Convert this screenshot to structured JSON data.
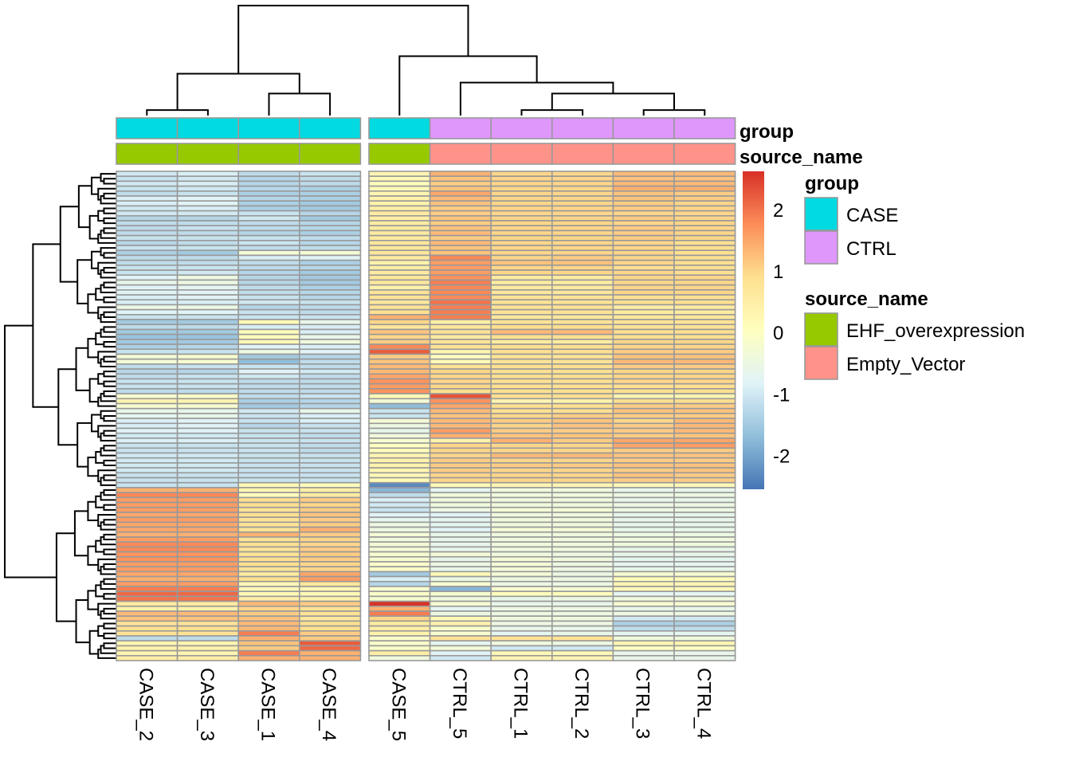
{
  "chart_data": {
    "type": "heatmap",
    "title": "",
    "columns": [
      "CASE_2",
      "CASE_3",
      "CASE_1",
      "CASE_4",
      "CASE_5",
      "CTRL_5",
      "CTRL_1",
      "CTRL_2",
      "CTRL_3",
      "CTRL_4"
    ],
    "column_split_after": 4,
    "row_count": 100,
    "annotations": {
      "group": {
        "label": "group",
        "values": [
          "CASE",
          "CASE",
          "CASE",
          "CASE",
          "CASE",
          "CTRL",
          "CTRL",
          "CTRL",
          "CTRL",
          "CTRL"
        ],
        "colors": {
          "CASE": "#00DAE0",
          "CTRL": "#DF97FC"
        }
      },
      "source_name": {
        "label": "source_name",
        "values": [
          "EHF_overexpression",
          "EHF_overexpression",
          "EHF_overexpression",
          "EHF_overexpression",
          "EHF_overexpression",
          "Empty_Vector",
          "Empty_Vector",
          "Empty_Vector",
          "Empty_Vector",
          "Empty_Vector"
        ],
        "colors": {
          "EHF_overexpression": "#97C900",
          "Empty_Vector": "#FF938A"
        }
      }
    },
    "colorbar": {
      "range": [
        -2.55,
        2.62
      ],
      "ticks": [
        2,
        1,
        0,
        -1,
        -2
      ],
      "tick_labels": [
        "2",
        "1",
        "0",
        "-1",
        "-2"
      ],
      "palette": [
        "#4575B4",
        "#91BFDB",
        "#E0F3F8",
        "#FFFFBF",
        "#FEE090",
        "#FC8D59",
        "#D73027"
      ]
    },
    "legend": {
      "position": "right",
      "groups": [
        {
          "title": "group",
          "items": [
            {
              "label": "CASE",
              "color": "#00DAE0"
            },
            {
              "label": "CTRL",
              "color": "#DF97FC"
            }
          ]
        },
        {
          "title": "source_name",
          "items": [
            {
              "label": "EHF_overexpression",
              "color": "#97C900"
            },
            {
              "label": "Empty_Vector",
              "color": "#FF938A"
            }
          ]
        }
      ]
    },
    "column_dendrogram": {
      "merges": [
        {
          "a": 0,
          "b": 1,
          "height": 0.05
        },
        {
          "a": 2,
          "b": 3,
          "height": 0.2
        },
        {
          "a": "m0",
          "b": "m1",
          "height": 0.38
        },
        {
          "a": 6,
          "b": 7,
          "height": 0.05
        },
        {
          "a": 8,
          "b": 9,
          "height": 0.05
        },
        {
          "a": "m3",
          "b": "m4",
          "height": 0.2
        },
        {
          "a": 5,
          "b": "m5",
          "height": 0.3
        },
        {
          "a": 4,
          "b": "m6",
          "height": 0.54
        },
        {
          "a": "m2",
          "b": "m7",
          "height": 1.0
        }
      ]
    },
    "values": [
      [
        -1.0,
        -0.9,
        -1.2,
        -1.1,
        0.3,
        1.4,
        1.0,
        1.0,
        1.3,
        1.3
      ],
      [
        -1.1,
        -1.0,
        -1.3,
        -1.2,
        0.2,
        1.2,
        1.0,
        1.0,
        1.2,
        1.2
      ],
      [
        -1.0,
        -0.9,
        -1.3,
        -1.2,
        0.1,
        1.1,
        1.0,
        1.0,
        1.3,
        1.3
      ],
      [
        -1.1,
        -1.0,
        -1.3,
        -1.4,
        0.2,
        1.2,
        1.0,
        1.0,
        1.4,
        1.4
      ],
      [
        -1.2,
        -1.1,
        -1.4,
        -1.4,
        0.3,
        1.5,
        1.0,
        1.0,
        1.2,
        1.1
      ],
      [
        -0.9,
        -0.8,
        -1.3,
        -1.4,
        0.4,
        1.3,
        1.0,
        1.0,
        1.2,
        1.1
      ],
      [
        -0.9,
        -0.8,
        -1.4,
        -1.5,
        0.4,
        1.2,
        1.0,
        1.0,
        1.1,
        1.0
      ],
      [
        -1.0,
        -0.9,
        -1.4,
        -1.5,
        0.5,
        1.1,
        1.0,
        1.0,
        1.1,
        1.0
      ],
      [
        -1.0,
        -1.0,
        -1.1,
        -1.3,
        0.6,
        1.1,
        1.0,
        1.0,
        1.0,
        1.0
      ],
      [
        -1.3,
        -1.3,
        -1.0,
        -1.5,
        0.5,
        1.2,
        1.0,
        1.0,
        1.1,
        1.0
      ],
      [
        -1.2,
        -1.2,
        -1.2,
        -1.3,
        0.6,
        1.1,
        1.0,
        1.0,
        1.0,
        1.0
      ],
      [
        -1.2,
        -1.1,
        -1.2,
        -1.3,
        0.6,
        1.2,
        1.0,
        1.0,
        1.1,
        1.0
      ],
      [
        -1.2,
        -1.2,
        -1.3,
        -1.4,
        0.6,
        1.3,
        1.0,
        1.0,
        1.1,
        1.0
      ],
      [
        -1.1,
        -1.1,
        -1.1,
        -1.2,
        0.6,
        1.1,
        1.0,
        1.0,
        1.1,
        1.0
      ],
      [
        -1.3,
        -1.2,
        -1.1,
        -1.3,
        0.7,
        1.3,
        1.0,
        1.0,
        1.0,
        0.9
      ],
      [
        -1.1,
        -1.1,
        -1.2,
        -1.2,
        0.7,
        1.2,
        1.0,
        1.0,
        1.0,
        0.9
      ],
      [
        -1.4,
        -1.5,
        -0.3,
        -0.3,
        0.7,
        1.2,
        1.0,
        1.0,
        1.0,
        0.9
      ],
      [
        -1.2,
        -1.2,
        -0.9,
        -0.8,
        0.6,
        1.8,
        1.0,
        1.1,
        1.0,
        0.9
      ],
      [
        -1.2,
        -1.2,
        -1.2,
        -1.4,
        0.4,
        1.6,
        1.2,
        1.2,
        1.0,
        0.9
      ],
      [
        -1.1,
        -1.1,
        -1.2,
        -1.3,
        0.5,
        1.6,
        1.0,
        1.0,
        0.9,
        0.9
      ],
      [
        -1.1,
        -1.0,
        -1.3,
        -1.5,
        0.6,
        1.6,
        1.0,
        1.0,
        1.0,
        0.9
      ],
      [
        -0.8,
        -0.5,
        -1.3,
        -1.5,
        0.7,
        1.7,
        0.6,
        0.6,
        1.0,
        1.0
      ],
      [
        -0.6,
        -0.5,
        -1.3,
        -1.5,
        0.7,
        1.9,
        0.6,
        0.6,
        1.0,
        1.0
      ],
      [
        -0.8,
        -0.7,
        -1.2,
        -1.4,
        0.4,
        1.8,
        0.6,
        0.6,
        1.0,
        1.0
      ],
      [
        -0.8,
        -0.8,
        -1.2,
        -1.3,
        0.8,
        1.8,
        0.7,
        0.7,
        1.0,
        1.0
      ],
      [
        -0.9,
        -0.8,
        -1.1,
        -1.3,
        0.8,
        1.8,
        0.8,
        0.8,
        0.9,
        0.9
      ],
      [
        -0.9,
        -0.9,
        -1.0,
        -1.1,
        0.7,
        2.0,
        0.8,
        0.8,
        0.9,
        0.9
      ],
      [
        -0.5,
        -0.5,
        -1.3,
        -1.2,
        0.8,
        1.9,
        0.8,
        0.8,
        0.5,
        0.6
      ],
      [
        -0.8,
        -0.8,
        -1.1,
        -1.2,
        0.9,
        1.9,
        0.8,
        0.8,
        0.6,
        0.6
      ],
      [
        -1.1,
        -1.1,
        -1.1,
        -1.1,
        1.4,
        1.9,
        0.7,
        0.7,
        0.7,
        0.7
      ],
      [
        -1.5,
        -1.5,
        0.2,
        -0.6,
        1.0,
        0.5,
        0.8,
        0.8,
        0.8,
        0.8
      ],
      [
        -1.2,
        -1.2,
        -0.9,
        -0.9,
        0.7,
        0.7,
        0.9,
        0.9,
        0.8,
        0.8
      ],
      [
        -1.5,
        -1.5,
        0.1,
        -0.9,
        1.2,
        0.8,
        1.3,
        1.3,
        0.9,
        0.9
      ],
      [
        -1.6,
        -1.6,
        0.1,
        -0.6,
        1.0,
        0.6,
        0.9,
        0.9,
        0.9,
        0.9
      ],
      [
        -1.5,
        -1.5,
        0.2,
        -0.4,
        1.1,
        0.8,
        0.6,
        0.6,
        1.0,
        1.0
      ],
      [
        -1.4,
        -1.3,
        -0.8,
        -0.9,
        1.8,
        0.8,
        0.9,
        0.9,
        1.0,
        1.0
      ],
      [
        -1.1,
        -1.1,
        -0.5,
        -0.8,
        2.2,
        0.3,
        0.9,
        0.9,
        1.1,
        1.1
      ],
      [
        -0.3,
        -0.2,
        -1.5,
        -1.3,
        1.1,
        0.0,
        0.8,
        0.8,
        1.2,
        1.2
      ],
      [
        -0.3,
        -0.2,
        -1.7,
        -1.2,
        1.2,
        0.2,
        0.8,
        0.8,
        1.3,
        1.3
      ],
      [
        -1.2,
        -1.1,
        -1.1,
        -1.2,
        1.3,
        0.8,
        0.9,
        0.9,
        1.1,
        1.1
      ],
      [
        -1.3,
        -1.3,
        -0.8,
        -1.0,
        1.3,
        1.0,
        0.9,
        0.9,
        1.0,
        1.0
      ],
      [
        -1.2,
        -1.1,
        -1.0,
        -1.2,
        1.5,
        1.0,
        0.9,
        0.9,
        1.0,
        1.0
      ],
      [
        -1.1,
        -1.1,
        -1.2,
        -1.2,
        1.7,
        1.0,
        0.9,
        0.9,
        1.0,
        1.0
      ],
      [
        -1.1,
        -1.1,
        -1.2,
        -1.2,
        1.6,
        1.0,
        0.9,
        0.9,
        0.9,
        0.9
      ],
      [
        -1.2,
        -1.2,
        -1.2,
        -1.2,
        1.7,
        0.9,
        0.9,
        0.9,
        0.9,
        0.9
      ],
      [
        -0.2,
        -0.1,
        -1.2,
        -1.1,
        0.2,
        2.3,
        0.9,
        0.9,
        0.3,
        0.3
      ],
      [
        0.3,
        0.3,
        -1.4,
        -1.3,
        -0.3,
        1.7,
        0.3,
        0.4,
        0.9,
        0.9
      ],
      [
        -0.2,
        -0.2,
        -1.5,
        -1.3,
        -1.7,
        1.5,
        0.9,
        0.9,
        1.1,
        1.1
      ],
      [
        -0.6,
        -0.6,
        -1.0,
        -0.6,
        -1.1,
        1.3,
        0.9,
        0.9,
        1.2,
        1.2
      ],
      [
        -0.7,
        -0.6,
        -1.1,
        -0.9,
        -1.1,
        1.2,
        1.0,
        1.1,
        1.1,
        1.1
      ],
      [
        -0.9,
        -0.8,
        -1.1,
        -0.9,
        -0.3,
        1.3,
        1.1,
        1.2,
        1.0,
        1.3
      ],
      [
        -0.9,
        -0.8,
        -1.3,
        -1.1,
        -0.5,
        1.3,
        1.0,
        1.2,
        1.1,
        1.3
      ],
      [
        -0.8,
        -0.8,
        -1.1,
        -1.1,
        -0.6,
        1.6,
        1.1,
        1.1,
        1.1,
        1.3
      ],
      [
        -1.0,
        -1.0,
        -1.1,
        -1.2,
        -0.4,
        1.4,
        1.2,
        1.2,
        1.1,
        1.2
      ],
      [
        -0.9,
        -0.9,
        -1.1,
        -1.1,
        -0.2,
        0.4,
        1.4,
        1.1,
        1.5,
        1.5
      ],
      [
        -1.1,
        -1.1,
        -1.1,
        -1.2,
        0.0,
        1.0,
        1.0,
        1.0,
        1.5,
        1.6
      ],
      [
        -1.1,
        -1.1,
        -1.1,
        -1.2,
        0.1,
        1.0,
        1.0,
        1.0,
        1.1,
        1.1
      ],
      [
        -1.0,
        -1.0,
        -1.1,
        -1.1,
        0.3,
        1.0,
        1.3,
        1.3,
        1.2,
        1.2
      ],
      [
        -1.0,
        -1.0,
        -1.1,
        -1.1,
        0.4,
        1.1,
        1.0,
        1.0,
        1.1,
        1.1
      ],
      [
        -1.0,
        -1.0,
        -1.1,
        -1.1,
        0.4,
        1.1,
        1.1,
        1.1,
        1.2,
        1.2
      ],
      [
        -1.0,
        -1.0,
        -1.1,
        -1.1,
        0.3,
        1.1,
        1.0,
        1.0,
        1.1,
        1.2
      ],
      [
        -1.1,
        -1.1,
        -1.1,
        -1.1,
        0.2,
        1.0,
        1.0,
        1.0,
        1.2,
        1.1
      ],
      [
        -1.1,
        -1.1,
        -1.1,
        -1.1,
        0.2,
        1.0,
        1.0,
        1.0,
        1.1,
        1.1
      ],
      [
        -1.1,
        -1.1,
        0.2,
        0.1,
        -2.3,
        0.2,
        0.3,
        0.3,
        0.2,
        0.2
      ],
      [
        1.4,
        1.4,
        0.3,
        0.5,
        -1.8,
        -0.7,
        -0.4,
        -0.4,
        -0.6,
        -0.6
      ],
      [
        1.8,
        1.8,
        0.1,
        0.6,
        -1.2,
        -0.4,
        -0.4,
        -0.4,
        -0.5,
        -0.5
      ],
      [
        1.6,
        1.6,
        0.9,
        1.1,
        -0.9,
        -0.4,
        -0.4,
        -0.4,
        -0.6,
        -0.6
      ],
      [
        1.6,
        1.6,
        0.9,
        1.0,
        -1.0,
        -0.4,
        -0.4,
        -0.4,
        -0.5,
        -0.5
      ],
      [
        1.6,
        1.6,
        0.8,
        1.1,
        -1.1,
        -0.5,
        -0.3,
        -0.3,
        -0.5,
        -0.5
      ],
      [
        1.5,
        1.5,
        0.9,
        1.2,
        -0.8,
        -0.8,
        -0.4,
        -0.4,
        -0.6,
        -0.6
      ],
      [
        1.6,
        1.6,
        0.8,
        1.1,
        -0.7,
        -0.7,
        -0.4,
        -0.4,
        -0.6,
        -0.6
      ],
      [
        1.5,
        1.5,
        0.8,
        1.1,
        -0.5,
        -0.7,
        -0.4,
        -0.4,
        -0.6,
        -0.6
      ],
      [
        1.5,
        1.5,
        0.8,
        1.4,
        -0.5,
        -0.8,
        -0.3,
        -0.3,
        -0.6,
        -0.6
      ],
      [
        1.4,
        1.4,
        1.4,
        1.1,
        -0.3,
        -0.6,
        -0.4,
        -0.4,
        -0.5,
        -0.5
      ],
      [
        1.6,
        1.6,
        0.8,
        1.0,
        -0.4,
        -0.6,
        -0.4,
        -0.4,
        -0.4,
        -0.4
      ],
      [
        1.8,
        1.8,
        0.9,
        1.0,
        -0.3,
        -0.6,
        -0.4,
        -0.4,
        -0.4,
        -0.4
      ],
      [
        1.8,
        1.8,
        0.8,
        1.1,
        -0.3,
        -0.6,
        -0.4,
        -0.4,
        -0.6,
        -0.6
      ],
      [
        1.7,
        1.7,
        0.8,
        1.1,
        -0.2,
        -0.3,
        -0.4,
        -0.5,
        -0.6,
        -0.6
      ],
      [
        1.7,
        1.7,
        0.9,
        1.1,
        -0.2,
        -0.6,
        -0.3,
        -0.4,
        -0.7,
        -0.7
      ],
      [
        1.6,
        1.6,
        0.9,
        1.0,
        -0.1,
        -0.5,
        -0.3,
        -0.5,
        -0.7,
        -0.7
      ],
      [
        1.6,
        1.6,
        0.8,
        1.0,
        -0.1,
        -0.6,
        -0.3,
        -0.5,
        -0.6,
        -0.6
      ],
      [
        1.5,
        1.5,
        0.6,
        1.5,
        -1.5,
        0.2,
        -0.3,
        -0.5,
        -0.2,
        -0.2
      ],
      [
        1.4,
        1.4,
        0.9,
        1.6,
        -0.9,
        -0.5,
        -0.5,
        -0.5,
        0.1,
        0.1
      ],
      [
        1.6,
        1.6,
        0.2,
        0.7,
        -1.3,
        -0.2,
        -0.5,
        -0.5,
        0.3,
        0.3
      ],
      [
        1.9,
        1.9,
        0.2,
        0.3,
        -0.2,
        -1.8,
        -0.2,
        -0.3,
        0.2,
        0.2
      ],
      [
        2.1,
        2.1,
        0.2,
        0.2,
        -0.1,
        -0.2,
        0.1,
        0.1,
        -0.7,
        -0.7
      ],
      [
        2.0,
        2.0,
        0.5,
        0.4,
        -0.2,
        -0.4,
        -0.6,
        -0.5,
        -0.4,
        -0.4
      ],
      [
        0.6,
        0.6,
        1.3,
        1.1,
        2.6,
        -0.2,
        -0.6,
        -0.6,
        -0.2,
        -0.2
      ],
      [
        0.4,
        0.4,
        1.0,
        0.8,
        1.4,
        -0.7,
        -0.5,
        -0.5,
        -0.6,
        -0.6
      ],
      [
        1.3,
        1.3,
        1.1,
        0.8,
        1.9,
        -0.5,
        -0.5,
        -0.5,
        -0.5,
        -0.5
      ],
      [
        1.2,
        1.2,
        1.2,
        0.7,
        1.0,
        0.2,
        -0.4,
        -0.4,
        -1.0,
        -1.0
      ],
      [
        0.8,
        0.8,
        1.3,
        0.9,
        0.6,
        0.4,
        -0.5,
        -0.5,
        -1.4,
        -1.4
      ],
      [
        0.9,
        0.9,
        1.3,
        0.9,
        0.5,
        -0.1,
        -0.6,
        -0.6,
        -1.2,
        -1.2
      ],
      [
        0.8,
        0.8,
        1.9,
        1.1,
        0.4,
        -0.2,
        -0.7,
        -0.6,
        -0.7,
        -0.7
      ],
      [
        -1.2,
        -1.2,
        1.4,
        1.1,
        -0.1,
        0.8,
        0.8,
        0.8,
        -0.4,
        -0.4
      ],
      [
        0.3,
        0.3,
        1.2,
        2.2,
        -0.1,
        -0.7,
        -0.4,
        -0.5,
        0.3,
        0.3
      ],
      [
        0.4,
        0.4,
        1.1,
        2.1,
        -0.1,
        -0.3,
        -1.0,
        -1.0,
        0.0,
        0.0
      ],
      [
        0.3,
        0.3,
        1.9,
        1.4,
        0.5,
        -0.8,
        0.2,
        0.2,
        -0.6,
        -0.6
      ],
      [
        0.5,
        0.5,
        1.4,
        1.4,
        -0.4,
        -1.0,
        0.3,
        0.3,
        -0.6,
        -0.6
      ]
    ],
    "row_dendrogram": "hierarchical clustering of 100 rows (two major clusters: rows 0-63 and rows 64-99)"
  }
}
